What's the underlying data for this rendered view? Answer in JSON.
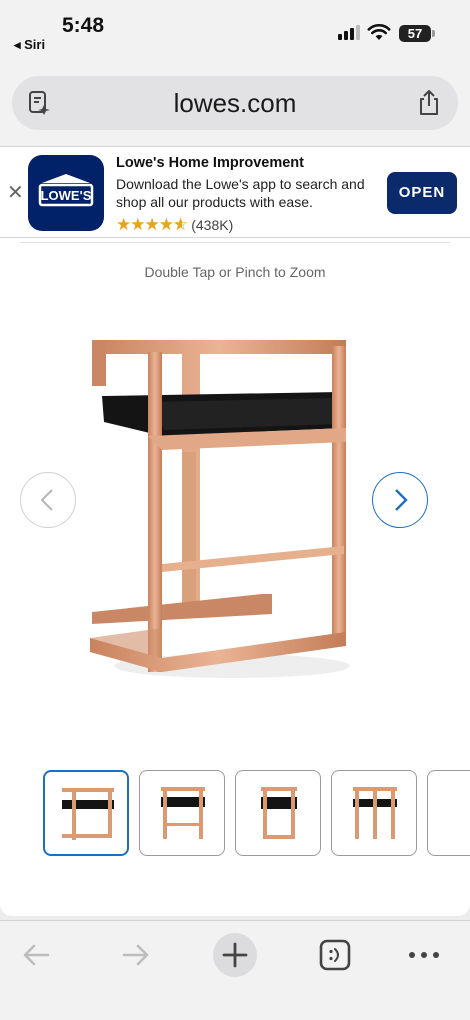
{
  "status_bar": {
    "time": "5:48",
    "back_app": "◂ Siri",
    "battery": "57"
  },
  "browser": {
    "url": "lowes.com",
    "page_icon": "page-menu-icon",
    "share_icon": "share-icon"
  },
  "app_banner": {
    "app_name": "Lowe's Home Improvement",
    "description": "Download the Lowe's app to search and shop all our products with ease.",
    "rating_count": "(438K)",
    "rating": 4.5,
    "open_label": "OPEN",
    "icon_text": "LOWE'S",
    "brand_color": "#012169"
  },
  "product": {
    "zoom_hint": "Double Tap or Pinch to Zoom",
    "thumbnail_count": 5,
    "active_thumbnail": 1,
    "accent_color": "#1f6fbf",
    "frame_color": "#d99a74",
    "seat_color": "#141414"
  },
  "toolbar": {
    "back_icon": "back-arrow-icon",
    "forward_icon": "forward-arrow-icon",
    "new_tab_icon": "plus-icon",
    "tabs_icon": "tabs-icon",
    "menu_icon": "more-icon"
  }
}
